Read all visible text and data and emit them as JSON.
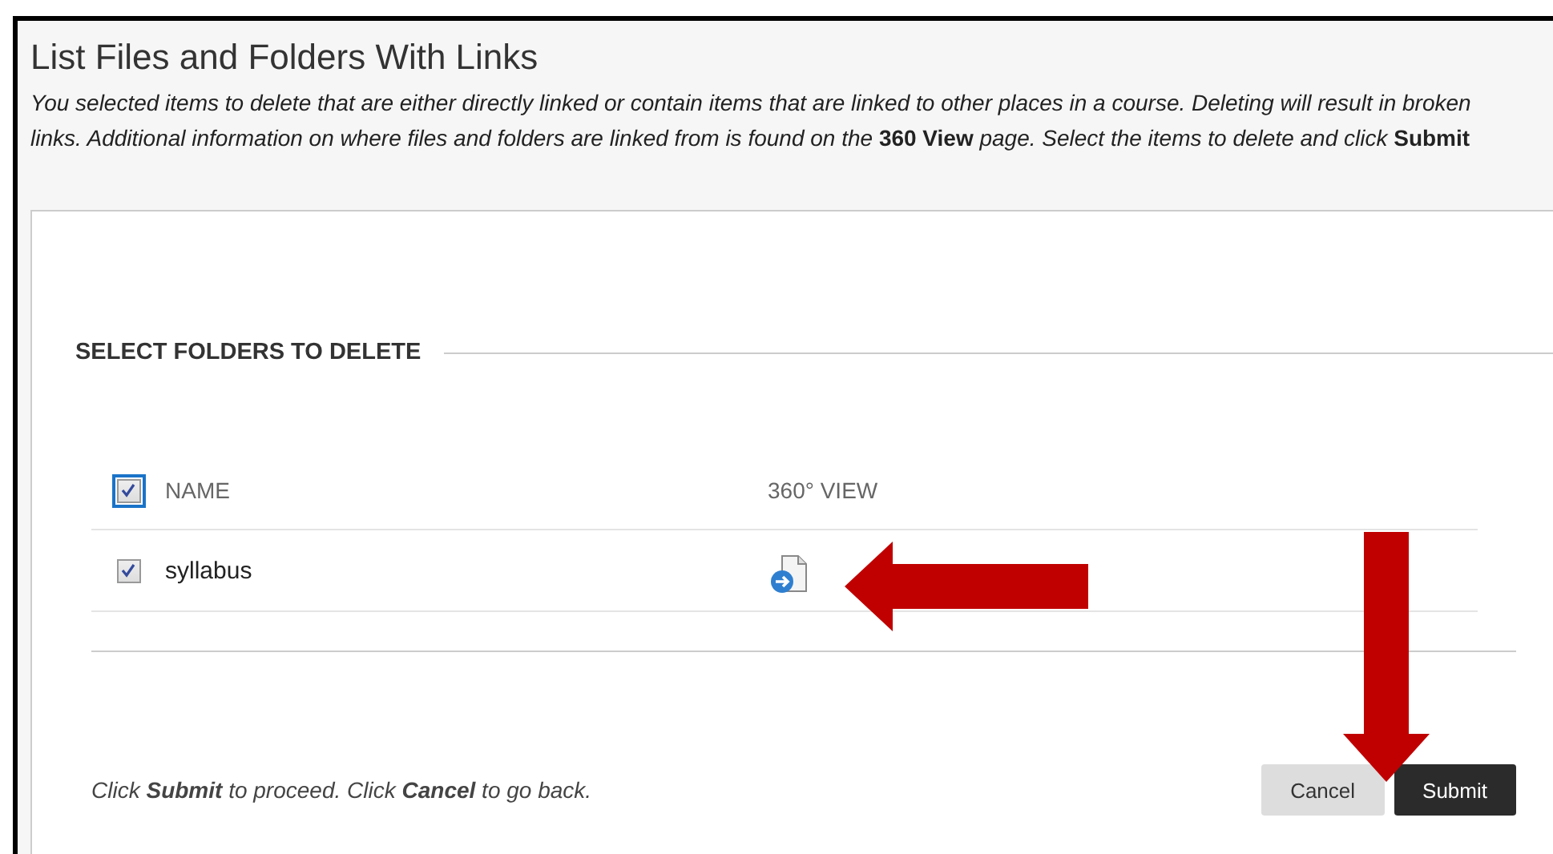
{
  "page": {
    "title": "List Files and Folders With Links",
    "description": "*You selected items to delete that are either directly linked or contain items that are linked to other places in a course. Deleting will result in broken*\n*links. Additional information on where files and folders are linked from is found on the* **360 View** *page. Select the items to delete and click* **Submit**"
  },
  "section": {
    "heading": "SELECT FOLDERS TO DELETE"
  },
  "table": {
    "select_all": {
      "checked": true
    },
    "columns": [
      "NAME",
      "360° VIEW"
    ],
    "rows": [
      {
        "name": "syllabus",
        "checked": true
      }
    ]
  },
  "footer": {
    "instructions": "Click **Submit** to proceed. Click **Cancel** to go back.",
    "buttons": [
      {
        "label": "Cancel",
        "kind": "secondary"
      },
      {
        "label": "Submit",
        "kind": "primary"
      }
    ]
  }
}
